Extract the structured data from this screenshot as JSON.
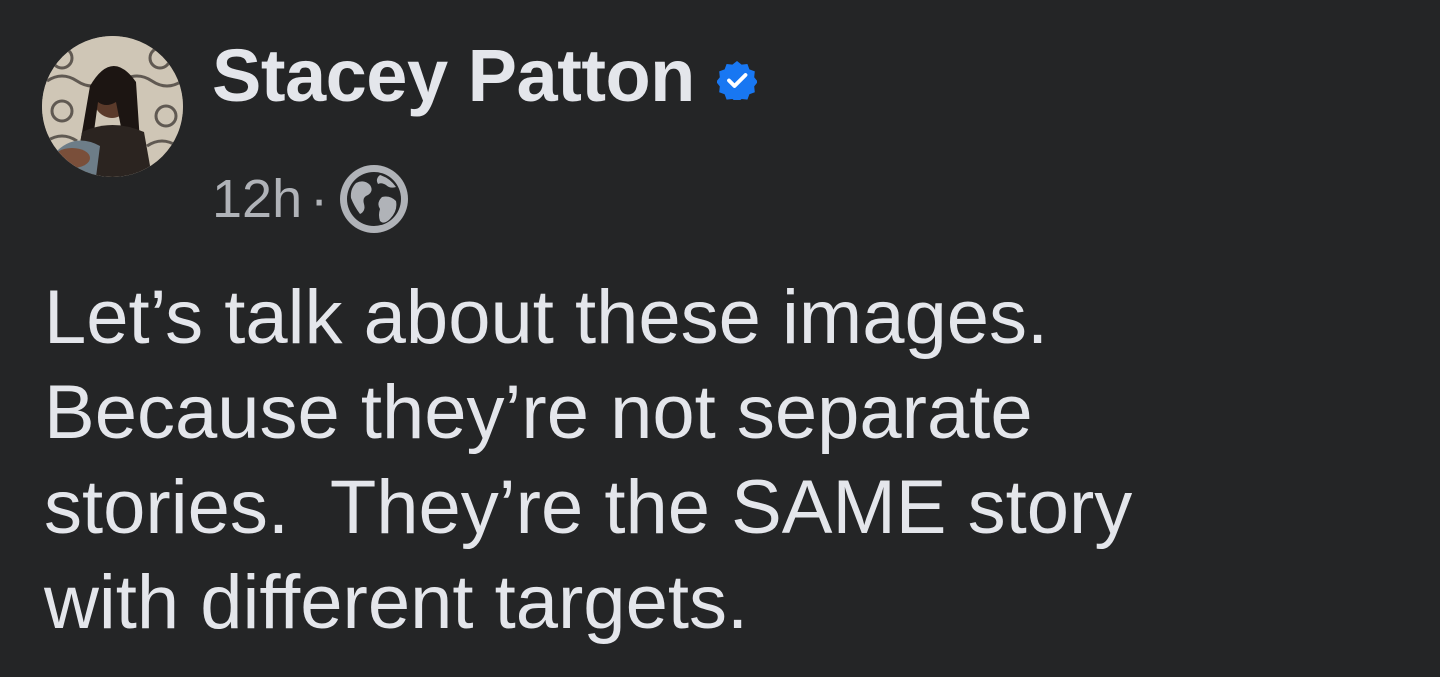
{
  "post": {
    "author": {
      "name": "Stacey Patton",
      "verified": true,
      "avatar_icon": "profile-photo"
    },
    "meta": {
      "timestamp": "12h",
      "separator": "·",
      "audience_icon": "globe-icon"
    },
    "body_text": "Let’s talk about these images.\nBecause they’re not separate\nstories.  They’re the SAME story\nwith different targets."
  },
  "colors": {
    "background": "#242526",
    "primary_text": "#e4e6eb",
    "secondary_text": "#b0b3b8",
    "verified_badge": "#1877f2"
  }
}
